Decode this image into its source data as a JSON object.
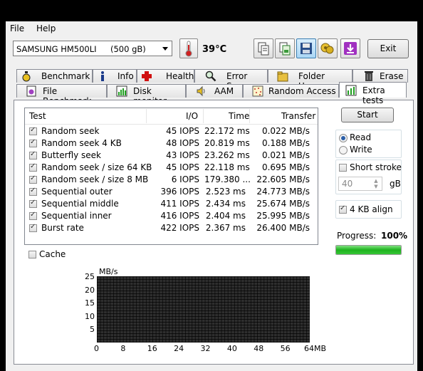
{
  "menu": {
    "file": "File",
    "help": "Help"
  },
  "drive": {
    "name": "SAMSUNG HM500LI",
    "size": "(500 gB)"
  },
  "temperature": "39°C",
  "toolbar": {
    "buttons": [
      "copy-text-icon",
      "copy-image-icon",
      "save-icon",
      "health-scan-icon",
      "download-icon"
    ],
    "exit_label": "Exit"
  },
  "tabs_row1": [
    {
      "label": "Benchmark",
      "icon": "benchmark-icon"
    },
    {
      "label": "Info",
      "icon": "info-icon"
    },
    {
      "label": "Health",
      "icon": "health-icon"
    },
    {
      "label": "Error Scan",
      "icon": "error-scan-icon"
    },
    {
      "label": "Folder Usage",
      "icon": "folder-icon"
    },
    {
      "label": "Erase",
      "icon": "erase-icon"
    }
  ],
  "tabs_row2": [
    {
      "label": "File Benchmark",
      "icon": "file-benchmark-icon"
    },
    {
      "label": "Disk monitor",
      "icon": "disk-monitor-icon"
    },
    {
      "label": "AAM",
      "icon": "speaker-icon"
    },
    {
      "label": "Random Access",
      "icon": "random-access-icon"
    },
    {
      "label": "Extra tests",
      "icon": "extra-tests-icon",
      "selected": true
    }
  ],
  "results": {
    "headers": {
      "test": "Test",
      "io": "I/O",
      "time": "Time",
      "transfer": "Transfer"
    },
    "rows": [
      {
        "checked": true,
        "test": "Random seek",
        "io": "45 IOPS",
        "time": "22.172 ms",
        "transfer": "0.022 MB/s"
      },
      {
        "checked": true,
        "test": "Random seek 4 KB",
        "io": "48 IOPS",
        "time": "20.819 ms",
        "transfer": "0.188 MB/s"
      },
      {
        "checked": true,
        "test": "Butterfly seek",
        "io": "43 IOPS",
        "time": "23.262 ms",
        "transfer": "0.021 MB/s"
      },
      {
        "checked": true,
        "test": "Random seek / size 64 KB",
        "io": "45 IOPS",
        "time": "22.118 ms",
        "transfer": "0.695 MB/s"
      },
      {
        "checked": true,
        "test": "Random seek / size 8 MB",
        "io": "6 IOPS",
        "time": "179.380 ...",
        "transfer": "22.605 MB/s"
      },
      {
        "checked": true,
        "test": "Sequential outer",
        "io": "396 IOPS",
        "time": "2.523 ms",
        "transfer": "24.773 MB/s"
      },
      {
        "checked": true,
        "test": "Sequential middle",
        "io": "411 IOPS",
        "time": "2.434 ms",
        "transfer": "25.674 MB/s"
      },
      {
        "checked": true,
        "test": "Sequential inner",
        "io": "416 IOPS",
        "time": "2.404 ms",
        "transfer": "25.995 MB/s"
      },
      {
        "checked": true,
        "test": "Burst rate",
        "io": "422 IOPS",
        "time": "2.367 ms",
        "transfer": "26.400 MB/s"
      }
    ]
  },
  "cache": {
    "label": "Cache",
    "checked": false
  },
  "controls": {
    "start_label": "Start",
    "read_label": "Read",
    "write_label": "Write",
    "mode": "read",
    "short_stroke_label": "Short stroke",
    "short_stroke_checked": false,
    "stroke_value": "40",
    "stroke_unit": "gB",
    "align_label": "4 KB align",
    "align_checked": true,
    "progress_label": "Progress:",
    "progress_value": "100%",
    "progress_fraction": 1.0
  },
  "chart": {
    "ylabel": "MB/s",
    "yticks": [
      "25",
      "20",
      "15",
      "10",
      "5"
    ],
    "xticks": [
      "0",
      "8",
      "16",
      "24",
      "32",
      "40",
      "48",
      "56",
      "64MB"
    ]
  },
  "colors": {
    "progress": "#1eb31e",
    "selected_radio": "#2b5fa8"
  }
}
